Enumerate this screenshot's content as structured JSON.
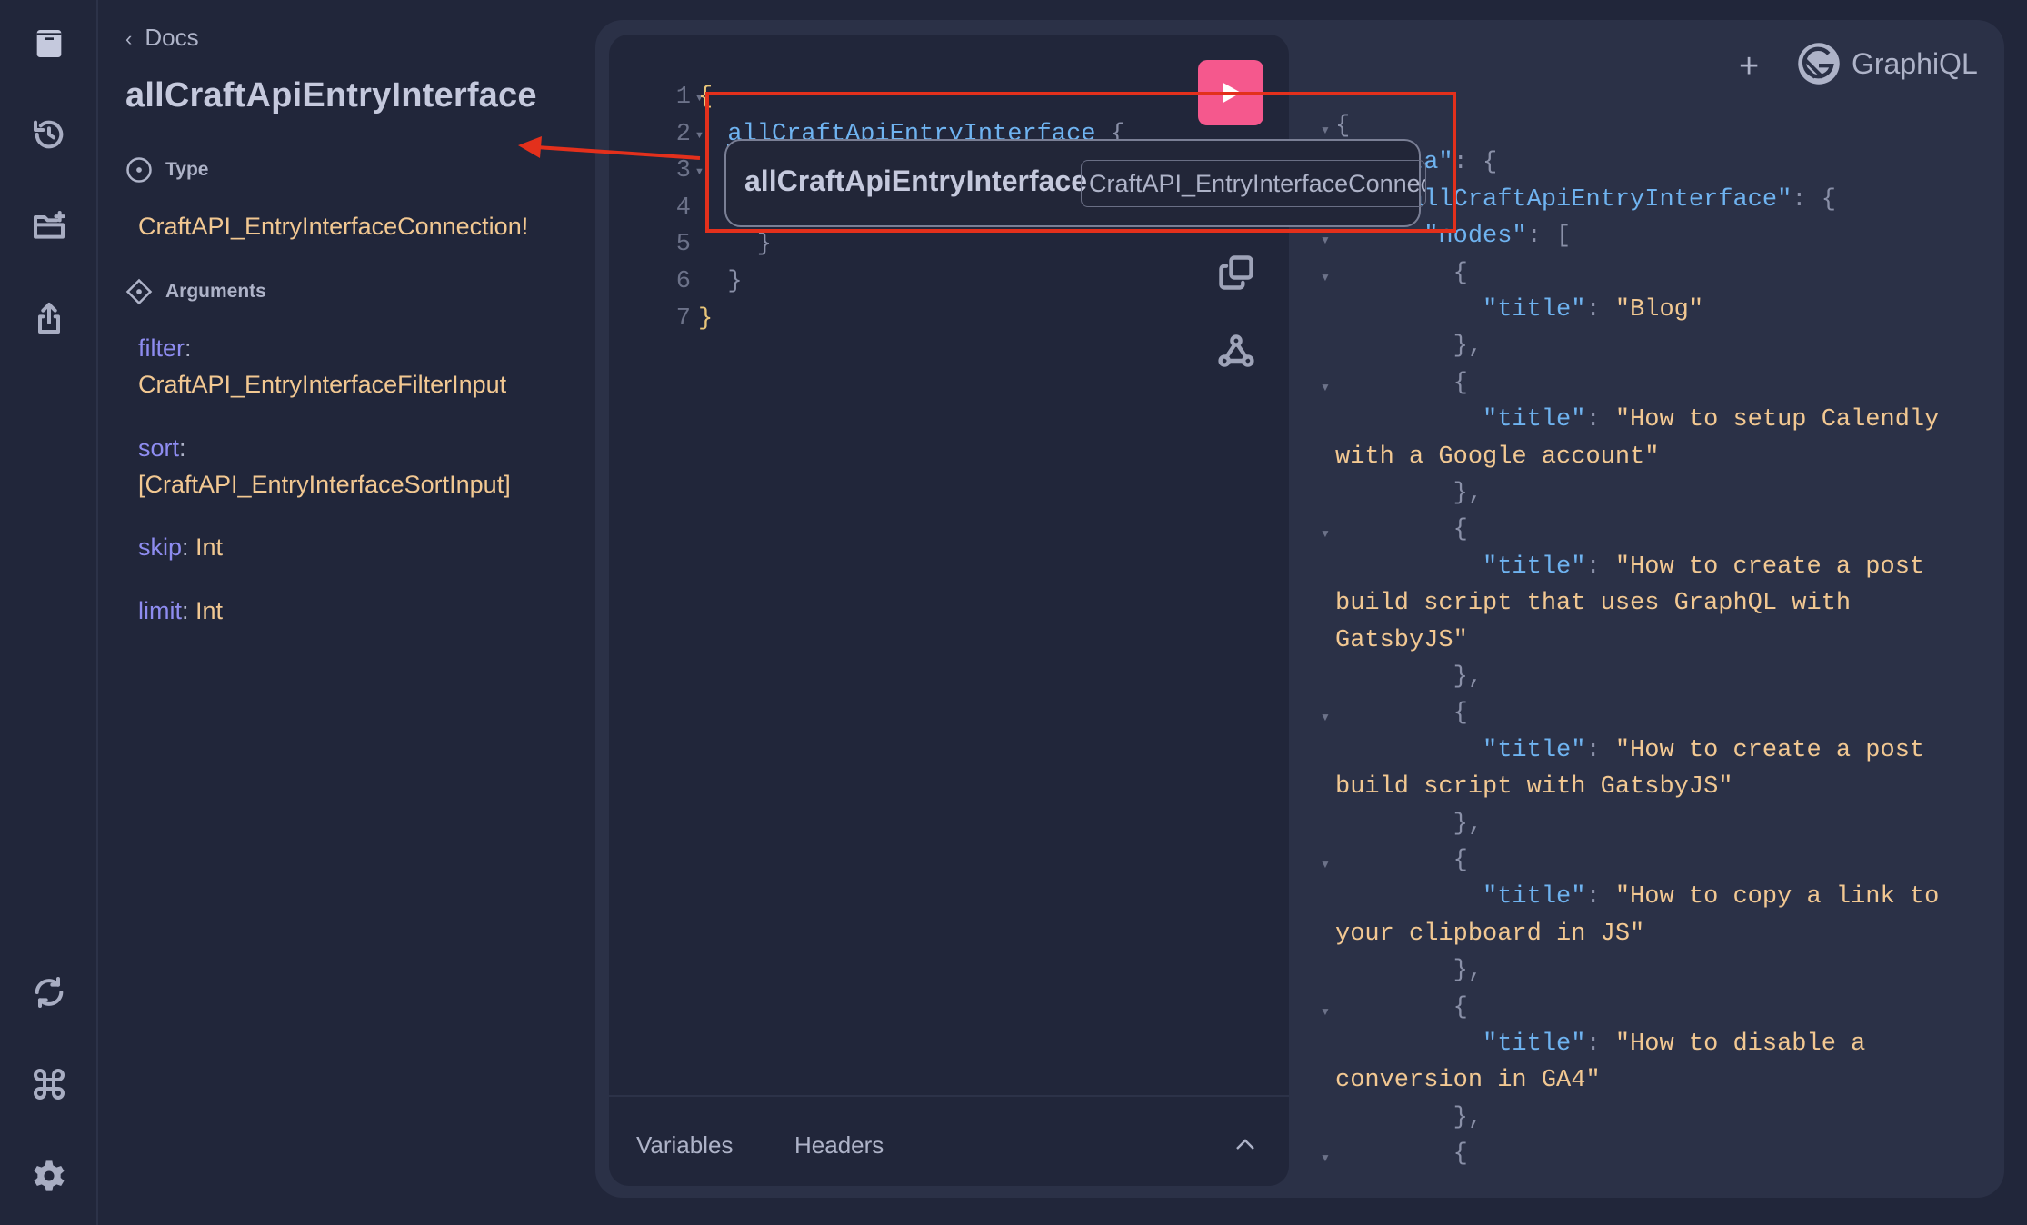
{
  "sidebar": {
    "icons": [
      "docs-book-icon",
      "history-icon",
      "add-folder-icon",
      "share-icon",
      "refresh-icon",
      "command-key-icon",
      "gear-icon"
    ]
  },
  "docs": {
    "back_label": "Docs",
    "title": "allCraftApiEntryInterface",
    "type_heading": "Type",
    "type_value": "CraftAPI_EntryInterfaceConnection!",
    "arguments_heading": "Arguments",
    "arguments": [
      {
        "name": "filter",
        "type": "CraftAPI_EntryInterfaceFilterInput"
      },
      {
        "name": "sort",
        "type": "[CraftAPI_EntryInterfaceSortInput]"
      },
      {
        "name": "skip",
        "type": "Int"
      },
      {
        "name": "limit",
        "type": "Int"
      }
    ]
  },
  "editor": {
    "lines": [
      {
        "n": "1",
        "fold": true,
        "tokens": [
          [
            "y",
            "{"
          ]
        ]
      },
      {
        "n": "2",
        "fold": true,
        "tokens": [
          [
            "p",
            "  "
          ],
          [
            "fld",
            "allCraftApiEntryInterface"
          ],
          [
            "p",
            " {"
          ]
        ]
      },
      {
        "n": "3",
        "fold": true,
        "tokens": []
      },
      {
        "n": "4",
        "fold": false,
        "tokens": []
      },
      {
        "n": "5",
        "fold": false,
        "tokens": [
          [
            "p",
            "    }"
          ]
        ]
      },
      {
        "n": "6",
        "fold": false,
        "tokens": [
          [
            "p",
            "  }"
          ]
        ]
      },
      {
        "n": "7",
        "fold": false,
        "tokens": [
          [
            "y",
            "}"
          ]
        ]
      }
    ],
    "run_icon": "play-icon",
    "tools": [
      "prettify-icon",
      "copy-icon",
      "merge-fragments-icon"
    ],
    "variables_tab": "Variables",
    "headers_tab": "Headers"
  },
  "header": {
    "add_tab_icon": "plus-icon",
    "logo_icon": "graphiql-logo-icon",
    "title": "GraphiQL"
  },
  "tooltip": {
    "name": "allCraftApiEntryInterface",
    "type": "CraftAPI_EntryInterfaceConnection!"
  },
  "colors": {
    "accent_run": "#f5588d",
    "annotation_red": "#e3301c",
    "key": "#6fb3f0",
    "string": "#f2c892",
    "argument": "#8e8cf0"
  },
  "result": {
    "lines": [
      {
        "fold": true,
        "tokens": [
          [
            "p",
            "{"
          ]
        ]
      },
      {
        "fold": true,
        "tokens": [
          [
            "p",
            "  "
          ],
          [
            "k",
            "\"data\""
          ],
          [
            "p",
            ": {"
          ]
        ]
      },
      {
        "fold": true,
        "tokens": [
          [
            "p",
            "    "
          ],
          [
            "k",
            "\"allCraftApiEntryInterface\""
          ],
          [
            "p",
            ": {"
          ]
        ]
      },
      {
        "fold": true,
        "tokens": [
          [
            "p",
            "      "
          ],
          [
            "k",
            "\"nodes\""
          ],
          [
            "p",
            ": ["
          ]
        ]
      },
      {
        "fold": true,
        "tokens": [
          [
            "p",
            "        {"
          ]
        ]
      },
      {
        "fold": false,
        "tokens": [
          [
            "p",
            "          "
          ],
          [
            "k",
            "\"title\""
          ],
          [
            "p",
            ": "
          ],
          [
            "s",
            "\"Blog\""
          ]
        ]
      },
      {
        "fold": false,
        "tokens": [
          [
            "p",
            "        },"
          ]
        ]
      },
      {
        "fold": true,
        "tokens": [
          [
            "p",
            "        {"
          ]
        ]
      },
      {
        "fold": false,
        "tokens": [
          [
            "p",
            "          "
          ],
          [
            "k",
            "\"title\""
          ],
          [
            "p",
            ": "
          ],
          [
            "s",
            "\"How to setup Calendly"
          ]
        ]
      },
      {
        "fold": false,
        "tokens": [
          [
            "s",
            "with a Google account\""
          ]
        ]
      },
      {
        "fold": false,
        "tokens": [
          [
            "p",
            "        },"
          ]
        ]
      },
      {
        "fold": true,
        "tokens": [
          [
            "p",
            "        {"
          ]
        ]
      },
      {
        "fold": false,
        "tokens": [
          [
            "p",
            "          "
          ],
          [
            "k",
            "\"title\""
          ],
          [
            "p",
            ": "
          ],
          [
            "s",
            "\"How to create a post"
          ]
        ]
      },
      {
        "fold": false,
        "tokens": [
          [
            "s",
            "build script that uses GraphQL with"
          ]
        ]
      },
      {
        "fold": false,
        "tokens": [
          [
            "s",
            "GatsbyJS\""
          ]
        ]
      },
      {
        "fold": false,
        "tokens": [
          [
            "p",
            "        },"
          ]
        ]
      },
      {
        "fold": true,
        "tokens": [
          [
            "p",
            "        {"
          ]
        ]
      },
      {
        "fold": false,
        "tokens": [
          [
            "p",
            "          "
          ],
          [
            "k",
            "\"title\""
          ],
          [
            "p",
            ": "
          ],
          [
            "s",
            "\"How to create a post"
          ]
        ]
      },
      {
        "fold": false,
        "tokens": [
          [
            "s",
            "build script with GatsbyJS\""
          ]
        ]
      },
      {
        "fold": false,
        "tokens": [
          [
            "p",
            "        },"
          ]
        ]
      },
      {
        "fold": true,
        "tokens": [
          [
            "p",
            "        {"
          ]
        ]
      },
      {
        "fold": false,
        "tokens": [
          [
            "p",
            "          "
          ],
          [
            "k",
            "\"title\""
          ],
          [
            "p",
            ": "
          ],
          [
            "s",
            "\"How to copy a link to"
          ]
        ]
      },
      {
        "fold": false,
        "tokens": [
          [
            "s",
            "your clipboard in JS\""
          ]
        ]
      },
      {
        "fold": false,
        "tokens": [
          [
            "p",
            "        },"
          ]
        ]
      },
      {
        "fold": true,
        "tokens": [
          [
            "p",
            "        {"
          ]
        ]
      },
      {
        "fold": false,
        "tokens": [
          [
            "p",
            "          "
          ],
          [
            "k",
            "\"title\""
          ],
          [
            "p",
            ": "
          ],
          [
            "s",
            "\"How to disable a"
          ]
        ]
      },
      {
        "fold": false,
        "tokens": [
          [
            "s",
            "conversion in GA4\""
          ]
        ]
      },
      {
        "fold": false,
        "tokens": [
          [
            "p",
            "        },"
          ]
        ]
      },
      {
        "fold": true,
        "tokens": [
          [
            "p",
            "        {"
          ]
        ]
      }
    ]
  }
}
